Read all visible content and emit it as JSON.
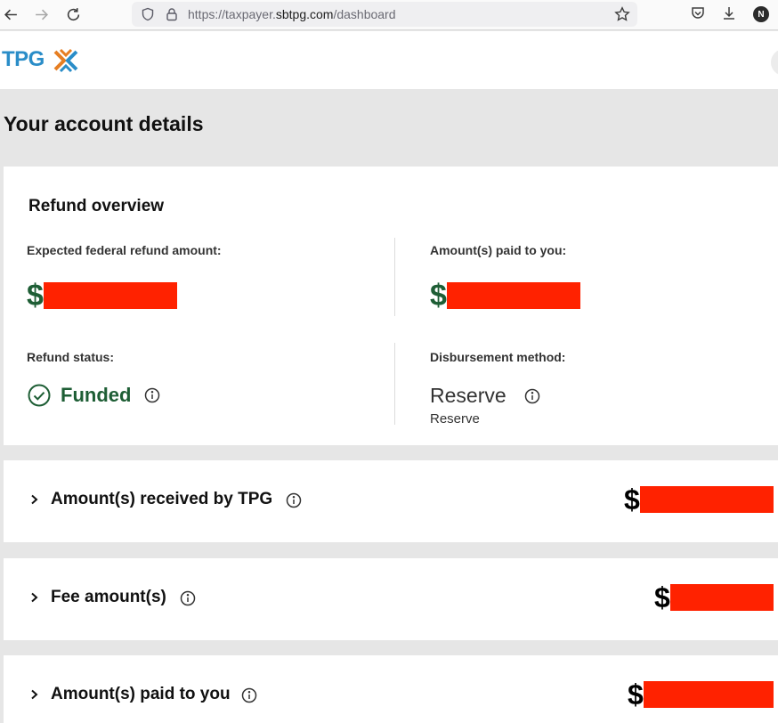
{
  "browser": {
    "url_scheme": "https://",
    "url_sub": "taxpayer.",
    "url_host": "sbtpg.com",
    "url_path": "/dashboard",
    "profile_initial": "N"
  },
  "header": {
    "logo_text": "TPG",
    "logo_colors": {
      "text": "#2a8dc8",
      "mark_orange": "#e67e22",
      "mark_blue": "#2a8dc8"
    }
  },
  "page": {
    "title": "Your account details"
  },
  "overview": {
    "title": "Refund overview",
    "expected_label": "Expected federal refund amount:",
    "expected_currency": "$",
    "paid_label": "Amount(s) paid to you:",
    "paid_currency": "$",
    "status_label": "Refund status:",
    "status_value": "Funded",
    "method_label": "Disbursement method:",
    "method_value": "Reserve",
    "method_sub": "Reserve"
  },
  "rows": [
    {
      "label": "Amount(s) received by TPG",
      "currency": "$"
    },
    {
      "label": "Fee amount(s)",
      "currency": "$"
    },
    {
      "label": "Amount(s) paid to you",
      "currency": "$"
    }
  ],
  "colors": {
    "accent_green": "#1e5e35",
    "redaction": "#ff2200",
    "page_bg": "#e6e6e6"
  },
  "icons": [
    "back-arrow-icon",
    "forward-arrow-icon",
    "reload-icon",
    "shield-icon",
    "lock-icon",
    "star-icon",
    "pocket-icon",
    "download-icon",
    "check-circle-icon",
    "info-icon",
    "chevron-right-icon"
  ]
}
